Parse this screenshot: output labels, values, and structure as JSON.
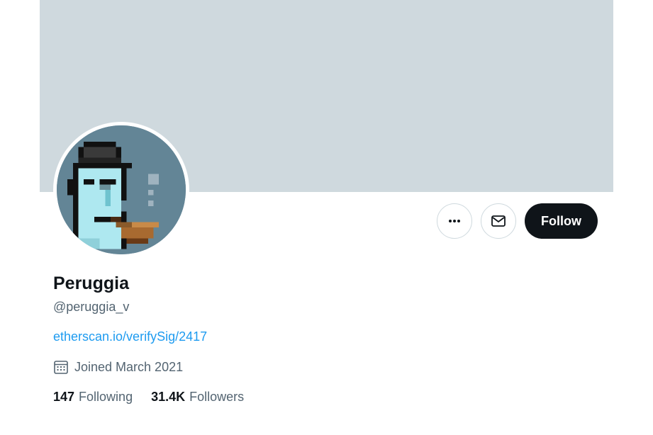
{
  "profile": {
    "display_name": "Peruggia",
    "handle": "@peruggia_v",
    "website": "etherscan.io/verifySig/2417",
    "joined": "Joined March 2021",
    "following_count": "147",
    "following_label": "Following",
    "followers_count": "31.4K",
    "followers_label": "Followers"
  },
  "actions": {
    "more_icon": "more-horizontal-icon",
    "message_icon": "envelope-icon",
    "follow_label": "Follow"
  },
  "colors": {
    "banner": "#cfd9de",
    "follow_button": "#0f1419",
    "link": "#1d9bf0",
    "secondary_text": "#536471",
    "avatar_background": "#638596"
  }
}
